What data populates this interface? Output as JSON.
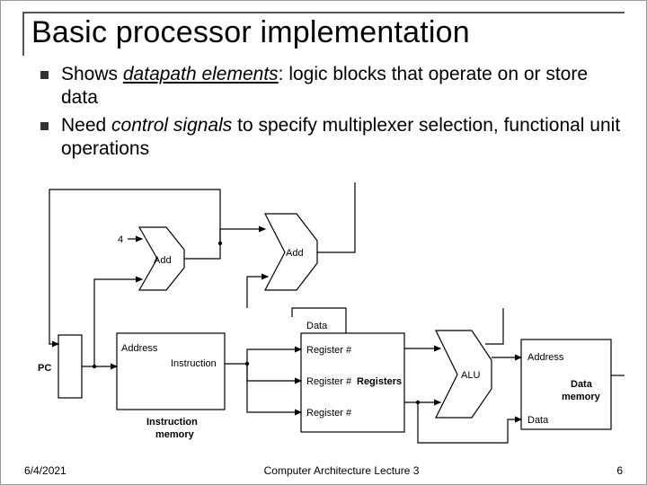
{
  "title": "Basic processor implementation",
  "bullets": [
    {
      "pre": "Shows ",
      "em_u": "datapath elements",
      "post": ": logic blocks that operate on or store data"
    },
    {
      "pre": "Need ",
      "em": "control signals",
      "post": " to specify multiplexer selection, functional unit operations"
    }
  ],
  "diagram": {
    "const4": "4",
    "add1": "Add",
    "add2": "Add",
    "pc": "PC",
    "im_addr": "Address",
    "im_instr": "Instruction",
    "im_name1": "Instruction",
    "im_name2": "memory",
    "data": "Data",
    "reg_hash": "Register #",
    "registers": "Registers",
    "alu": "ALU",
    "dm_addr": "Address",
    "dm_name1": "Data",
    "dm_name2": "memory",
    "dm_data": "Data"
  },
  "footer": {
    "date": "6/4/2021",
    "center": "Computer Architecture Lecture 3",
    "page": "6"
  }
}
